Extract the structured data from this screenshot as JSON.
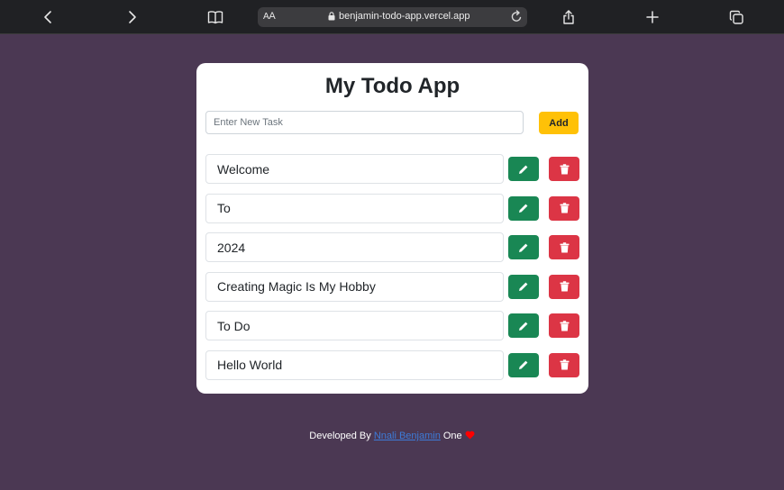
{
  "browser": {
    "aa_label_small": "A",
    "aa_label_big": "A",
    "url": "benjamin-todo-app.vercel.app",
    "icons": [
      "back-icon",
      "forward-icon",
      "bookmarks-icon",
      "lock-icon",
      "reload-icon",
      "share-icon",
      "new-tab-icon",
      "tabs-icon"
    ]
  },
  "app": {
    "title": "My Todo App",
    "new_task_placeholder": "Enter New Task",
    "new_task_value": "",
    "add_label": "Add",
    "todos": [
      {
        "text": "Welcome"
      },
      {
        "text": "To"
      },
      {
        "text": "2024"
      },
      {
        "text": "Creating Magic Is My Hobby"
      },
      {
        "text": "To Do"
      },
      {
        "text": "Hello World"
      }
    ],
    "edit_icon": "pencil-icon",
    "delete_icon": "trash-icon",
    "colors": {
      "background": "#4b3853",
      "add_button": "#ffc107",
      "edit_button": "#198754",
      "delete_button": "#dc3545"
    }
  },
  "footer": {
    "prefix": "Developed By",
    "author": "Nnali Benjamin",
    "suffix": "One",
    "heart_icon": "heart-icon"
  }
}
